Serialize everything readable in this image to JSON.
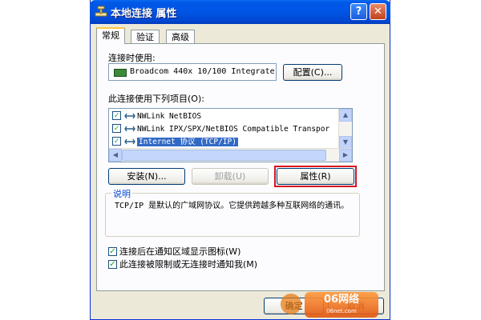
{
  "window": {
    "title": "本地连接 属性",
    "help_label": "?",
    "close_label": "✕"
  },
  "tabs": [
    {
      "label": "常规",
      "active": true
    },
    {
      "label": "验证",
      "active": false
    },
    {
      "label": "高级",
      "active": false
    }
  ],
  "connect_using": {
    "label": "连接时使用:",
    "device": "Broadcom 440x 10/100 Integrate",
    "configure_button": "配置(C)..."
  },
  "components": {
    "label": "此连接使用下列项目(O):",
    "items": [
      {
        "label": "NWLink NetBIOS",
        "checked": true,
        "selected": false
      },
      {
        "label": "NWLink IPX/SPX/NetBIOS Compatible Transpor",
        "checked": true,
        "selected": false
      },
      {
        "label": "Internet 协议 (TCP/IP)",
        "checked": true,
        "selected": true
      }
    ]
  },
  "buttons": {
    "install": "安装(N)...",
    "uninstall": "卸载(U)",
    "properties": "属性(R)"
  },
  "description": {
    "title": "说明",
    "text": "TCP/IP 是默认的广域网协议。它提供跨越多种互联网络的通讯。"
  },
  "options": [
    {
      "label": "连接后在通知区域显示图标(W)",
      "checked": true
    },
    {
      "label": "此连接被限制或无连接时通知我(M)",
      "checked": true
    }
  ],
  "footer": {
    "ok": "确定",
    "cancel": "取消"
  },
  "watermark": {
    "text": "06网络",
    "sub": "06net.com"
  },
  "colors": {
    "titlebar": "#0055e5",
    "highlight_frame": "#d8151d",
    "selection": "#316ac5"
  }
}
